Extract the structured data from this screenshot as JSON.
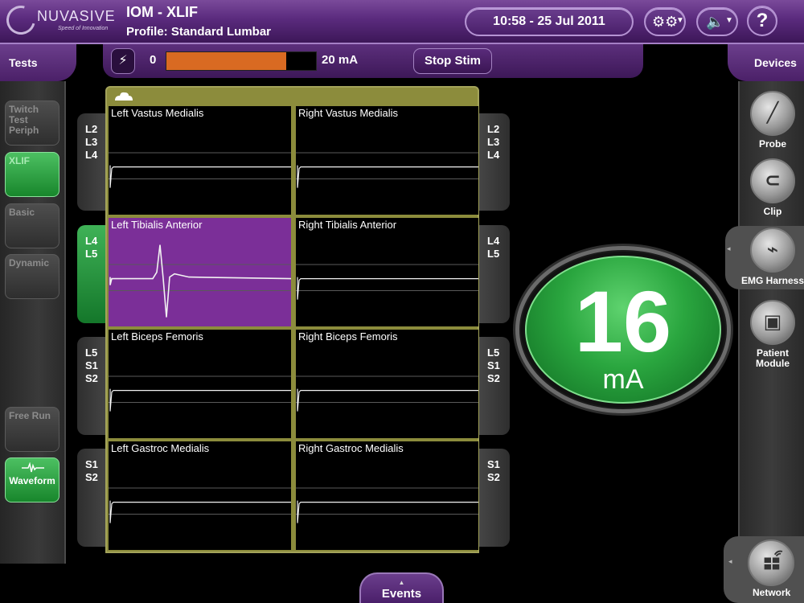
{
  "header": {
    "brand": "NUVASIVE",
    "tagline": "Speed of Innovation",
    "title": "IOM - XLIF",
    "profile": "Profile: Standard Lumbar",
    "datetime": "10:58 - 25 Jul 2011",
    "help_label": "?"
  },
  "tabs": {
    "tests": "Tests",
    "devices": "Devices",
    "events": "Events"
  },
  "stim": {
    "min_label": "0",
    "max_label": "20 mA",
    "current_ma": 16,
    "max_ma": 20,
    "fill_color": "#d96a22",
    "stop_label": "Stop Stim"
  },
  "tests": [
    {
      "label": "Twitch Test Periph",
      "active": false
    },
    {
      "label": "XLIF",
      "active": true
    },
    {
      "label": "Basic",
      "active": false
    },
    {
      "label": "Dynamic",
      "active": false
    },
    {
      "label": "Free Run",
      "active": false
    },
    {
      "label": "Waveform",
      "active": true
    }
  ],
  "devices": [
    {
      "label": "Probe",
      "icon": "probe-icon"
    },
    {
      "label": "Clip",
      "icon": "clip-icon"
    },
    {
      "label": "EMG Harness",
      "icon": "emg-harness-icon"
    },
    {
      "label": "Patient Module",
      "icon": "patient-module-icon"
    },
    {
      "label": "Network",
      "icon": "network-icon"
    }
  ],
  "rows": [
    {
      "levels": [
        "L2",
        "L3",
        "L4"
      ],
      "left": "Left Vastus Medialis",
      "right": "Right Vastus Medialis",
      "active": false
    },
    {
      "levels": [
        "L4",
        "L5"
      ],
      "left": "Left Tibialis Anterior",
      "right": "Right Tibialis Anterior",
      "active": true
    },
    {
      "levels": [
        "L5",
        "S1",
        "S2"
      ],
      "left": "Left Biceps Femoris",
      "right": "Right Biceps Femoris",
      "active": false
    },
    {
      "levels": [
        "S1",
        "S2"
      ],
      "left": "Left Gastroc Medialis",
      "right": "Right Gastroc Medialis",
      "active": false
    }
  ],
  "readout": {
    "value": "16",
    "unit": "mA",
    "status_color": "#2aa63f"
  },
  "colors": {
    "brand_purple": "#5a2a7d",
    "frame_olive": "#8c8c3c",
    "highlight_purple": "#7b2f98",
    "active_green": "#3fb257"
  }
}
